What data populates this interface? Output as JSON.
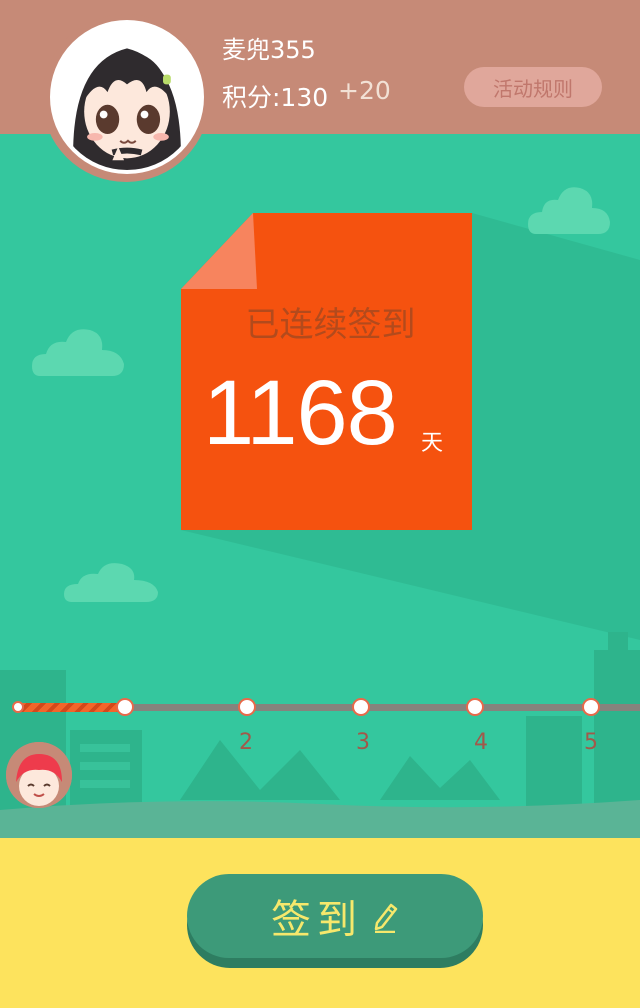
{
  "header": {
    "username": "麦兜355",
    "points_label": "积分:130",
    "points_gain": "+20",
    "rules_button": "活动规则"
  },
  "card": {
    "title": "已连续签到",
    "days": "1168",
    "unit": "天"
  },
  "progress": {
    "fraction": 0.17,
    "nodes": [
      "2",
      "3",
      "4",
      "5"
    ]
  },
  "action": {
    "sign_label": "签到"
  },
  "colors": {
    "header_bg": "#c68a77",
    "main_bg": "#34c79e",
    "card_bg": "#f5520f",
    "bottom_bg": "#fde35d",
    "button_bg": "#3d9a79",
    "button_text": "#f6e86c"
  },
  "icons": {
    "sign": "pencil-icon",
    "avatar": "anime-girl-avatar",
    "marker": "avatar-marker-icon"
  }
}
